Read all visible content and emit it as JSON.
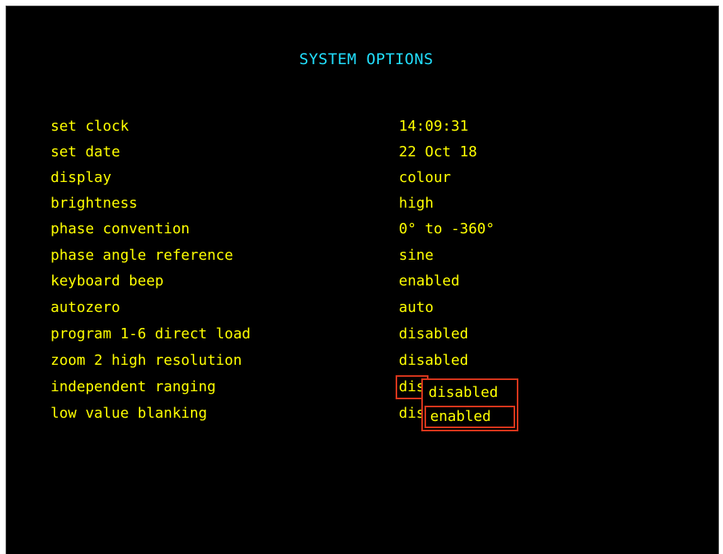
{
  "title": "SYSTEM OPTIONS",
  "options": [
    {
      "label": "set clock",
      "value": "14:09:31"
    },
    {
      "label": "set date",
      "value": "22 Oct 18"
    },
    {
      "label": "display",
      "value": "colour"
    },
    {
      "label": "brightness",
      "value": "high"
    },
    {
      "label": "phase convention",
      "value": "0° to -360°"
    },
    {
      "label": "phase angle reference",
      "value": "sine"
    },
    {
      "label": "keyboard beep",
      "value": "enabled"
    },
    {
      "label": "autozero",
      "value": "auto"
    },
    {
      "label": "program 1-6 direct load",
      "value": "disabled"
    },
    {
      "label": "zoom 2 high resolution",
      "value": "disabled"
    },
    {
      "label": "independent ranging",
      "value": "dis"
    },
    {
      "label": "low value blanking",
      "value": "dis"
    }
  ],
  "popup": {
    "items": [
      "disabled",
      "enabled"
    ],
    "highlighted": "enabled"
  },
  "colors": {
    "title": "#22e0ff",
    "text": "#ffff00",
    "highlight_border": "#d8361c",
    "background": "#000000"
  }
}
